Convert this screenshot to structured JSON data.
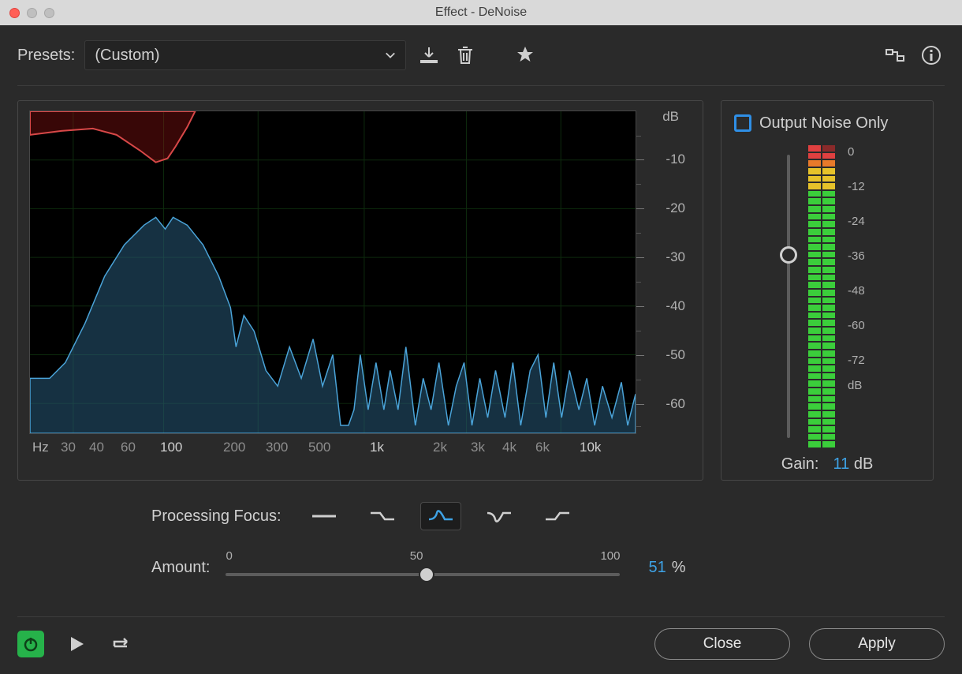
{
  "window": {
    "title": "Effect - DeNoise"
  },
  "toolbar": {
    "presets_label": "Presets:",
    "preset_value": "(Custom)"
  },
  "spectrum": {
    "db_unit": "dB",
    "db_ticks": [
      "-10",
      "-20",
      "-30",
      "-40",
      "-50",
      "-60"
    ],
    "hz_unit": "Hz",
    "hz_ticks": [
      "30",
      "40",
      "60",
      "100",
      "200",
      "300",
      "500",
      "1k",
      "2k",
      "3k",
      "4k",
      "6k",
      "10k"
    ]
  },
  "focus": {
    "label": "Processing Focus:"
  },
  "amount": {
    "label": "Amount:",
    "ticks": [
      "0",
      "50",
      "100"
    ],
    "value": "51",
    "unit": "%"
  },
  "gain": {
    "checkbox_label": "Output Noise Only",
    "meter_ticks": [
      "0",
      "-12",
      "-24",
      "-36",
      "-48",
      "-60",
      "-72",
      "dB"
    ],
    "label": "Gain:",
    "value": "11",
    "unit": "dB"
  },
  "footer": {
    "close": "Close",
    "apply": "Apply"
  }
}
